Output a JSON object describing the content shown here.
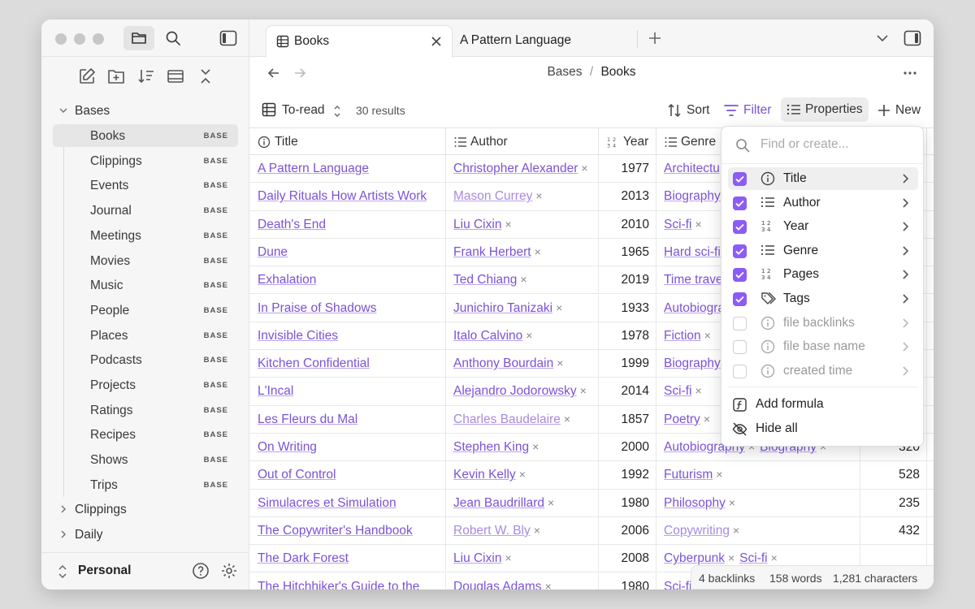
{
  "sidebar": {
    "folders": {
      "bases": "Bases",
      "clippings": "Clippings",
      "daily": "Daily"
    },
    "badge": "BASE",
    "files": [
      {
        "label": "Books"
      },
      {
        "label": "Clippings"
      },
      {
        "label": "Events"
      },
      {
        "label": "Journal"
      },
      {
        "label": "Meetings"
      },
      {
        "label": "Movies"
      },
      {
        "label": "Music"
      },
      {
        "label": "People"
      },
      {
        "label": "Places"
      },
      {
        "label": "Podcasts"
      },
      {
        "label": "Projects"
      },
      {
        "label": "Ratings"
      },
      {
        "label": "Recipes"
      },
      {
        "label": "Shows"
      },
      {
        "label": "Trips"
      }
    ],
    "vault_name": "Personal"
  },
  "tabs": {
    "active": "Books",
    "second": "A Pattern Language"
  },
  "breadcrumb": {
    "parent": "Bases",
    "separator": "/",
    "current": "Books"
  },
  "toolbar": {
    "view_name": "To-read",
    "results": "30 results",
    "sort": "Sort",
    "filter": "Filter",
    "properties": "Properties",
    "new": "New"
  },
  "table": {
    "columns": {
      "title": "Title",
      "author": "Author",
      "year": "Year",
      "genre": "Genre"
    },
    "rows": [
      {
        "title": "A Pattern Language",
        "author": "Christopher Alexander",
        "year": "1977",
        "genres": [
          "Architectu"
        ],
        "pages": ""
      },
      {
        "title": "Daily Rituals How Artists Work",
        "author": "Mason Currey",
        "author_muted": true,
        "year": "2013",
        "genres": [
          "Biography"
        ],
        "pages": ""
      },
      {
        "title": "Death's End",
        "author": "Liu Cixin",
        "year": "2010",
        "genres": [
          "Sci-fi"
        ],
        "pages": ""
      },
      {
        "title": "Dune",
        "author": "Frank Herbert",
        "year": "1965",
        "genres": [
          "Hard sci-fi"
        ],
        "pages": ""
      },
      {
        "title": "Exhalation",
        "author": "Ted Chiang",
        "year": "2019",
        "genres": [
          "Time travel"
        ],
        "pages": ""
      },
      {
        "title": "In Praise of Shadows",
        "author": "Junichiro Tanizaki",
        "year": "1933",
        "genres": [
          "Autobiogra"
        ],
        "pages": ""
      },
      {
        "title": "Invisible Cities",
        "author": "Italo Calvino",
        "year": "1978",
        "genres": [
          "Fiction"
        ],
        "pages": ""
      },
      {
        "title": "Kitchen Confidential",
        "author": "Anthony Bourdain",
        "year": "1999",
        "genres": [
          "Biography"
        ],
        "pages": ""
      },
      {
        "title": "L'Incal",
        "author": "Alejandro Jodorowsky",
        "year": "2014",
        "genres": [
          "Sci-fi"
        ],
        "pages": ""
      },
      {
        "title": "Les Fleurs du Mal",
        "author": "Charles Baudelaire",
        "author_muted": true,
        "year": "1857",
        "genres": [
          "Poetry"
        ],
        "pages": ""
      },
      {
        "title": "On Writing",
        "author": "Stephen King",
        "year": "2000",
        "genres": [
          "Autobiography",
          "Biography"
        ],
        "pages": "320"
      },
      {
        "title": "Out of Control",
        "author": "Kevin Kelly",
        "year": "1992",
        "genres": [
          "Futurism"
        ],
        "pages": "528"
      },
      {
        "title": "Simulacres et Simulation",
        "author": "Jean Baudrillard",
        "year": "1980",
        "genres": [
          "Philosophy"
        ],
        "pages": "235"
      },
      {
        "title": "The Copywriter's Handbook",
        "author": "Robert W. Bly",
        "author_muted": true,
        "year": "2006",
        "genres": [
          "Copywriting"
        ],
        "genre_muted": true,
        "pages": "432"
      },
      {
        "title": "The Dark Forest",
        "author": "Liu Cixin",
        "year": "2008",
        "genres": [
          "Cyberpunk",
          "Sci-fi"
        ],
        "pages": ""
      },
      {
        "title": "The Hitchhiker's Guide to the",
        "author": "Douglas Adams",
        "year": "1980",
        "genres": [
          "Sci-fi"
        ],
        "pages": ""
      }
    ]
  },
  "properties_menu": {
    "search_placeholder": "Find or create...",
    "items": [
      {
        "label": "Title",
        "checked": true,
        "icon": "info-icon"
      },
      {
        "label": "Author",
        "checked": true,
        "icon": "list-icon"
      },
      {
        "label": "Year",
        "checked": true,
        "icon": "number-icon"
      },
      {
        "label": "Genre",
        "checked": true,
        "icon": "list-icon"
      },
      {
        "label": "Pages",
        "checked": true,
        "icon": "number-icon"
      },
      {
        "label": "Tags",
        "checked": true,
        "icon": "tags-icon"
      },
      {
        "label": "file backlinks",
        "checked": false,
        "icon": "info-icon"
      },
      {
        "label": "file base name",
        "checked": false,
        "icon": "info-icon"
      },
      {
        "label": "created time",
        "checked": false,
        "icon": "info-icon"
      }
    ],
    "add_formula": "Add formula",
    "hide_all": "Hide all"
  },
  "status": {
    "backlinks": "4 backlinks",
    "words": "158 words",
    "characters": "1,281 characters"
  },
  "colors": {
    "accent": "#8b5cf6",
    "link": "#7b52d6"
  }
}
